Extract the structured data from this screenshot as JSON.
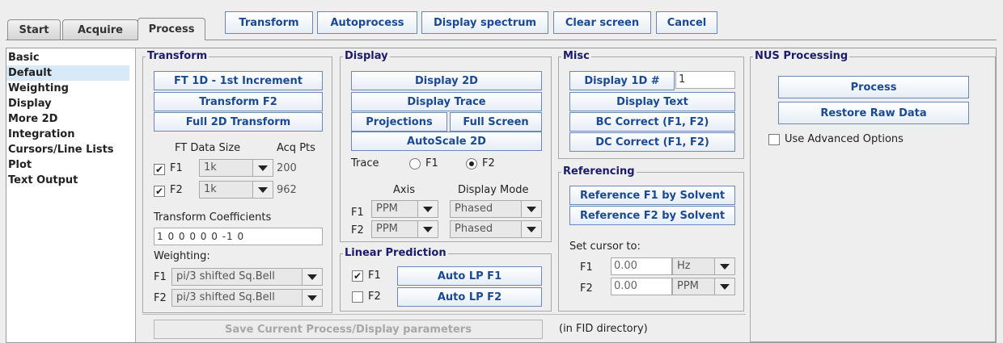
{
  "tabs": [
    {
      "label": "Start"
    },
    {
      "label": "Acquire"
    },
    {
      "label": "Process"
    }
  ],
  "toolbar": {
    "transform": "Transform",
    "autoprocess": "Autoprocess",
    "display_spectrum": "Display spectrum",
    "clear_screen": "Clear screen",
    "cancel": "Cancel"
  },
  "sidebar": {
    "items": [
      "Basic",
      "Default",
      "Weighting",
      "Display",
      "More 2D",
      "Integration",
      "Cursors/Line Lists",
      "Plot",
      "Text Output"
    ],
    "selected": "Default"
  },
  "transform": {
    "title": "Transform",
    "ft1d": "FT 1D - 1st Increment",
    "transform_f2": "Transform F2",
    "full_2d": "Full 2D Transform",
    "ft_data_size": "FT Data Size",
    "acq_pts": "Acq Pts",
    "f1_label": "F1",
    "f1_size": "1k",
    "f1_acq": "200",
    "f2_label": "F2",
    "f2_size": "1k",
    "f2_acq": "962",
    "coeff_label": "Transform Coefficients",
    "coeff_value": "1 0 0 0 0 0 -1 0",
    "weighting_label": "Weighting:",
    "w_f1_label": "F1",
    "w_f1": "pi/3 shifted Sq.Bell",
    "w_f2_label": "F2",
    "w_f2": "pi/3 shifted Sq.Bell"
  },
  "display": {
    "title": "Display",
    "display_2d": "Display 2D",
    "display_trace": "Display Trace",
    "projections": "Projections",
    "full_screen": "Full Screen",
    "autoscale": "AutoScale 2D",
    "trace_label": "Trace",
    "trace_f1": "F1",
    "trace_f2": "F2",
    "axis_label": "Axis",
    "mode_label": "Display Mode",
    "f1_label": "F1",
    "f1_axis": "PPM",
    "f1_mode": "Phased",
    "f2_label": "F2",
    "f2_axis": "PPM",
    "f2_mode": "Phased"
  },
  "lp": {
    "title": "Linear Prediction",
    "f1_label": "F1",
    "f2_label": "F2",
    "auto_f1": "Auto LP F1",
    "auto_f2": "Auto LP F2"
  },
  "misc": {
    "title": "Misc",
    "display_1d": "Display 1D #",
    "display_1d_value": "1",
    "display_text": "Display Text",
    "bc_correct": "BC Correct (F1, F2)",
    "dc_correct": "DC Correct (F1, F2)"
  },
  "referencing": {
    "title": "Referencing",
    "ref_f1": "Reference F1 by Solvent",
    "ref_f2": "Reference F2 by Solvent",
    "cursor_label": "Set cursor to:",
    "f1_label": "F1",
    "f1_value": "0.00",
    "f1_unit": "Hz",
    "f2_label": "F2",
    "f2_value": "0.00",
    "f2_unit": "PPM"
  },
  "nus": {
    "title": "NUS Processing",
    "process": "Process",
    "restore": "Restore Raw Data",
    "advanced": "Use Advanced Options"
  },
  "footer": {
    "save": "Save Current Process/Display parameters",
    "note": "(in FID directory)"
  }
}
